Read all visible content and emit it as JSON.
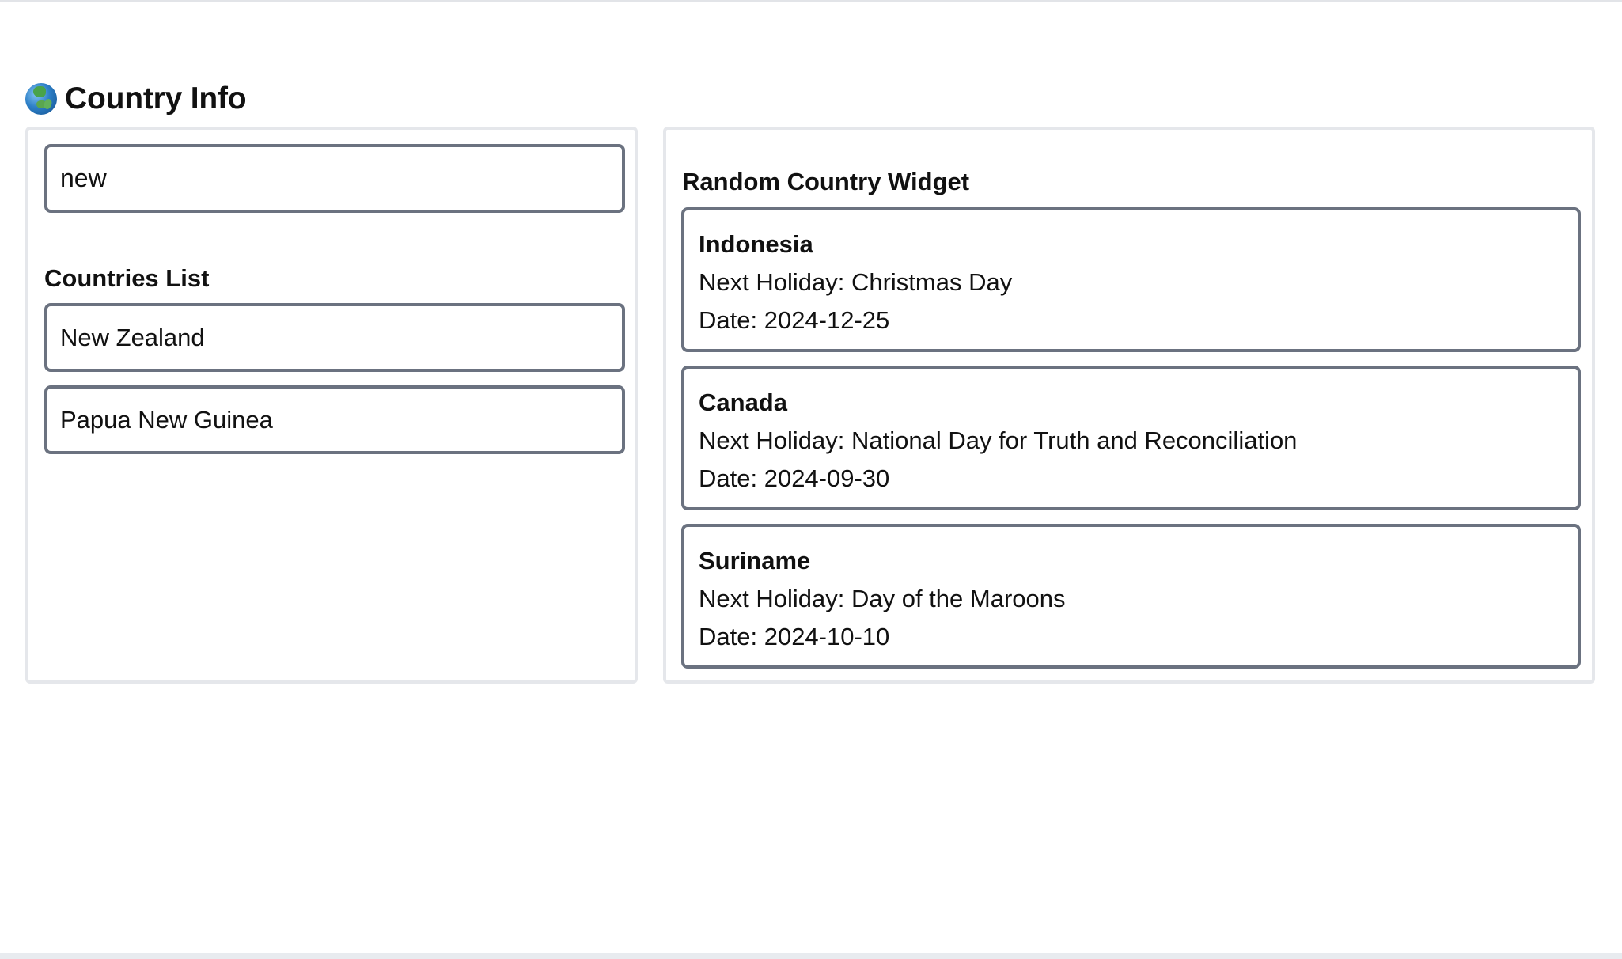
{
  "header": {
    "title": "Country Info",
    "icon": "globe-icon"
  },
  "search": {
    "value": "new"
  },
  "countries_list": {
    "title": "Countries List",
    "items": [
      "New Zealand",
      "Papua New Guinea"
    ]
  },
  "random_country_widget": {
    "title": "Random Country Widget",
    "cards": [
      {
        "country": "Indonesia",
        "holiday": "Next Holiday: Christmas Day",
        "date": "Date: 2024-12-25"
      },
      {
        "country": "Canada",
        "holiday": "Next Holiday: National Day for Truth and Reconciliation",
        "date": "Date: 2024-09-30"
      },
      {
        "country": "Suriname",
        "holiday": "Next Holiday: Day of the Maroons",
        "date": "Date: 2024-10-10"
      }
    ]
  },
  "colors": {
    "text": "#111111",
    "border": "#6b7280",
    "panel_border": "#e5e7eb"
  }
}
